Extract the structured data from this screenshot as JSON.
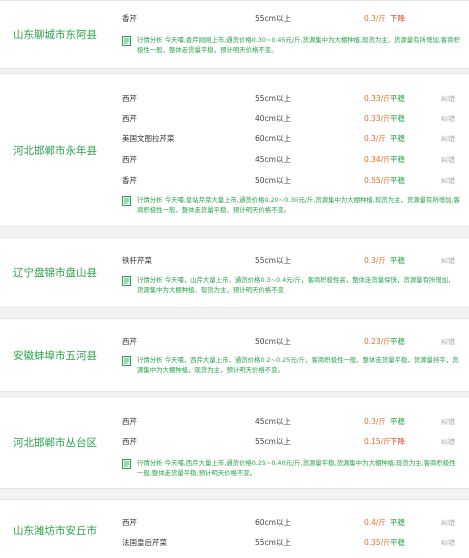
{
  "markets": [
    {
      "region": "山东聊城市东阿县",
      "rows": [
        {
          "variety": "香芹",
          "spec": "55cm以上",
          "price": "0.3/斤",
          "trend": "下降",
          "trend_type": "down",
          "fix": ""
        }
      ],
      "analysis": "行情分析 今天哺,香芹刚刚上市,通货价格0.30~0.45元/斤,货源集中为大棚种植,现货为主，货源量有所增加,客商积极性一般，整体走货量平稳，预计明天价格不变。"
    },
    {
      "region": "河北邯郸市永年县",
      "rows": [
        {
          "variety": "西芹",
          "spec": "55cm以上",
          "price": "0.33/斤",
          "trend": "平稳",
          "trend_type": "flat",
          "fix": "纠错"
        },
        {
          "variety": "西芹",
          "spec": "40cm以上",
          "price": "0.33/斤",
          "trend": "平稳",
          "trend_type": "flat",
          "fix": "纠错"
        },
        {
          "variety": "美国文图拉芹菜",
          "spec": "60cm以上",
          "price": "0.3/斤",
          "trend": "平稳",
          "trend_type": "flat",
          "fix": "纠错"
        },
        {
          "variety": "西芹",
          "spec": "45cm以上",
          "price": "0.34/斤",
          "trend": "平稳",
          "trend_type": "flat",
          "fix": "纠错"
        },
        {
          "variety": "香芹",
          "spec": "50cm以上",
          "price": "0.55/斤",
          "trend": "平稳",
          "trend_type": "flat",
          "fix": "纠错"
        }
      ],
      "analysis": "行情分析 今天哺,皇站芹菜大量上市,通货价格0.20~0.30元/斤,货源集中为大棚种植,现货为主，货源量有所增加,客商积极性一般，整体走货量平稳，预计明天价格不变。"
    },
    {
      "region": "辽宁盘锦市盘山县",
      "rows": [
        {
          "variety": "铁杆芹菜",
          "spec": "55cm以上",
          "price": "0.3/斤",
          "trend": "平稳",
          "trend_type": "flat",
          "fix": "纠错"
        }
      ],
      "analysis": "行情分析 今天哺，山芹大量上市，通货价格0.3~0.4元/斤，客商积极性高，整体走货量保快，货源量有所增加，货源集中为大棚种植，现货为主，预计明天价格不变"
    },
    {
      "region": "安徽蚌埠市五河县",
      "rows": [
        {
          "variety": "西芹",
          "spec": "50cm以上",
          "price": "0.23/斤",
          "trend": "平稳",
          "trend_type": "flat",
          "fix": "纠错"
        }
      ],
      "analysis": "行情分析 今天哺，西芹大量上市，通货价格0.2~0.25元/斤，客商积极性一般，整体走货量平稳，货源量持平，货源集中为大棚种植，现货为主，预计明天价格不变。"
    },
    {
      "region": "河北邯郸市丛台区",
      "rows": [
        {
          "variety": "西芹",
          "spec": "45cm以上",
          "price": "0.3/斤",
          "trend": "平稳",
          "trend_type": "flat",
          "fix": "纠错"
        },
        {
          "variety": "西芹",
          "spec": "55cm以上",
          "price": "0.15/斤",
          "trend": "下降",
          "trend_type": "down",
          "fix": "纠错"
        }
      ],
      "analysis": "行情分析 今天哺,西芹大量上市,通货价格0.25~0.40元/斤,货源量平稳,货源集中为大棚种植,现货为主,客商积极性一般,整体走货量平稳,预计明天价格不变。"
    },
    {
      "region": "山东潍坊市安丘市",
      "rows": [
        {
          "variety": "西芹",
          "spec": "60cm以上",
          "price": "0.4/斤",
          "trend": "平稳",
          "trend_type": "flat",
          "fix": "纠错"
        },
        {
          "variety": "法国皇后芹菜",
          "spec": "55cm以上",
          "price": "0.35/斤",
          "trend": "平稳",
          "trend_type": "flat",
          "fix": "纠错"
        }
      ],
      "analysis": ""
    }
  ],
  "colors": {
    "accent_green": "#2aa34a",
    "price_orange": "#f06b24",
    "down_red": "#e83b2e",
    "background": "#f3f3f3"
  },
  "icons": {
    "analysis": "document-icon"
  }
}
